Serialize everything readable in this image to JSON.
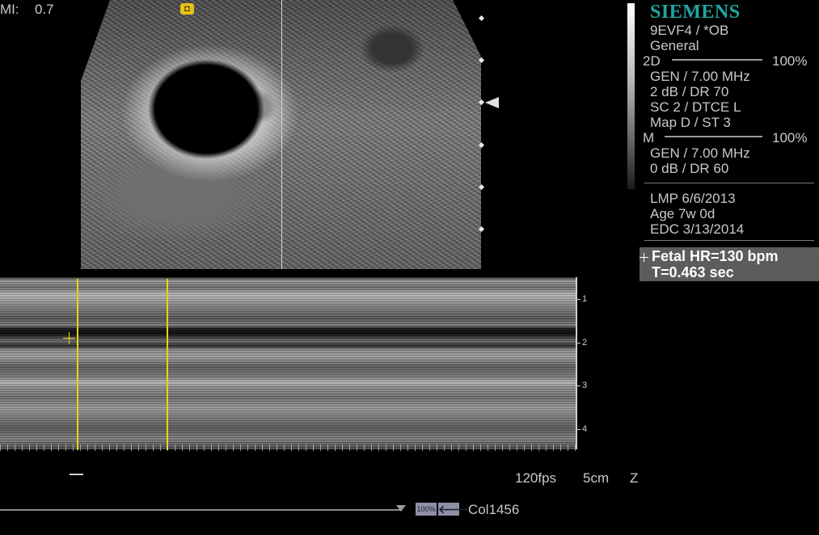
{
  "header": {
    "mi_label": "MI:",
    "mi_value": "0.7"
  },
  "brand": "SIEMENS",
  "panel": {
    "transducer": "9EVF4 / *OB",
    "preset": "General",
    "mode_2d": {
      "label": "2D",
      "power": "100%",
      "freq": "GEN / 7.00 MHz",
      "gain_dr": "2 dB / DR 70",
      "sc_dtce": "SC 2 / DTCE L",
      "map_st": "Map D / ST 3"
    },
    "mode_m": {
      "label": "M",
      "power": "100%",
      "freq": "GEN / 7.00 MHz",
      "gain_dr": "0 dB / DR 60"
    },
    "obstetric": {
      "lmp": "LMP 6/6/2013",
      "age": "Age 7w 0d",
      "edc": "EDC 3/13/2014"
    }
  },
  "measurement": {
    "fetal_hr": "Fetal HR=130 bpm",
    "t": "T=0.463 sec"
  },
  "depth_labels": [
    "1",
    "2",
    "3",
    "4"
  ],
  "status": {
    "fps": "120fps",
    "depth": "5cm",
    "zoom": "Z"
  },
  "footer": {
    "badge": "100%",
    "arrow": "🡐",
    "col": "Col1456"
  },
  "icons": {
    "orientation": "orientation-marker-icon",
    "focus": "focus-arrow-icon"
  },
  "colors": {
    "brand": "#1fa7a2",
    "caliper": "#e8d21a",
    "result_bg": "#5c5c5c"
  }
}
